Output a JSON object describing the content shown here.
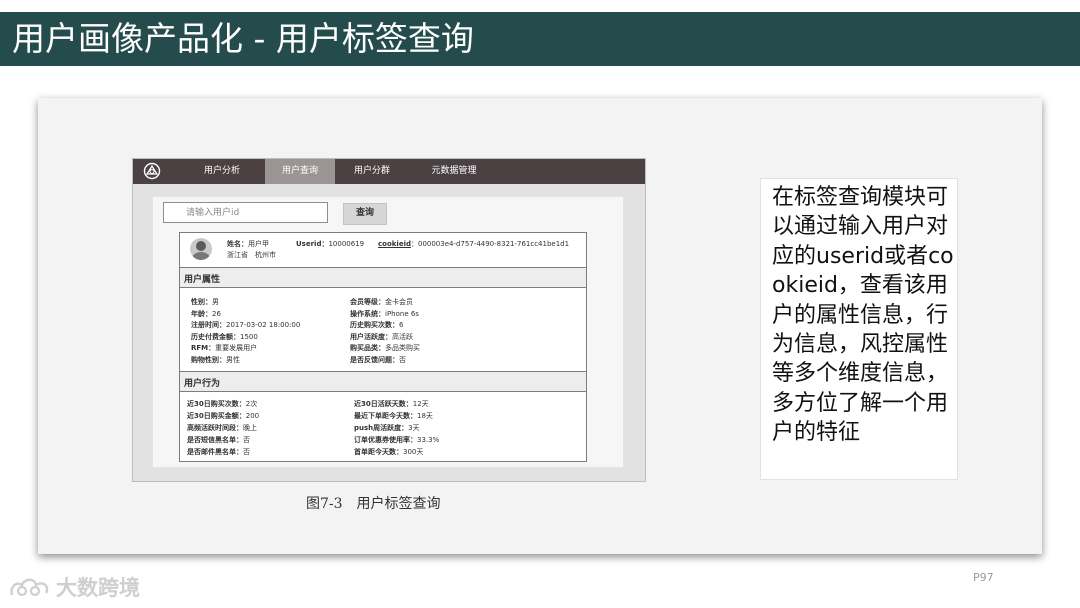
{
  "slide": {
    "title": "用户画像产品化 - 用户标签查询",
    "description": "在标签查询模块可以通过输入用户对应的userid或者cookieid，查看该用户的属性信息，行为信息，风控属性等多个维度信息，多方位了解一个用户的特征",
    "caption": "图7-3　用户标签查询",
    "page_number": "P97",
    "watermark": "大数跨境"
  },
  "app": {
    "nav": [
      "用户分析",
      "用户查询",
      "用户分群",
      "元数据管理"
    ],
    "search_placeholder": "请输入用户id",
    "search_button": "查询",
    "profile": {
      "name_label": "姓名：",
      "name": "用户甲",
      "userid_label": "Userid：",
      "userid": "10000619",
      "cookieid_label": "cookieid",
      "cookieid_sep": "：",
      "cookieid": "000003e4-d757-4490-8321-761cc41be1d1",
      "location": "浙江省　杭州市"
    },
    "attr_section_title": "用户属性",
    "attr_left": [
      {
        "label": "性别：",
        "value": "男"
      },
      {
        "label": "年龄：",
        "value": "26"
      },
      {
        "label": "注册时间：",
        "value": "2017-03-02 18:00:00"
      },
      {
        "label": "历史付费金额：",
        "value": "1500"
      },
      {
        "label": "RFM：",
        "value": "重要发展用户"
      },
      {
        "label": "购物性别：",
        "value": "男性"
      }
    ],
    "attr_right": [
      {
        "label": "会员等级：",
        "value": "金卡会员"
      },
      {
        "label": "操作系统：",
        "value": "iPhone 6s"
      },
      {
        "label": "历史购买次数：",
        "value": "6"
      },
      {
        "label": "用户活跃度：",
        "value": "高活跃"
      },
      {
        "label": "购买品类：",
        "value": "多品类购买"
      },
      {
        "label": "是否反馈问题：",
        "value": "否"
      }
    ],
    "behavior_section_title": "用户行为",
    "beh_left": [
      {
        "label": "近30日购买次数：",
        "value": "2次"
      },
      {
        "label": "近30日购买金额：",
        "value": "200"
      },
      {
        "label": "高频活跃时间段：",
        "value": "晚上"
      },
      {
        "label": "是否短信黑名单：",
        "value": "否"
      },
      {
        "label": "是否邮件黑名单：",
        "value": "否"
      }
    ],
    "beh_right": [
      {
        "label": "近30日活跃天数：",
        "value": "12天"
      },
      {
        "label": "最近下单距今天数：",
        "value": "18天"
      },
      {
        "label": "push周活跃度：",
        "value": "3天"
      },
      {
        "label": "订单优惠券使用率：",
        "value": "33.3%"
      },
      {
        "label": "首单距今天数：",
        "value": "300天"
      }
    ]
  }
}
